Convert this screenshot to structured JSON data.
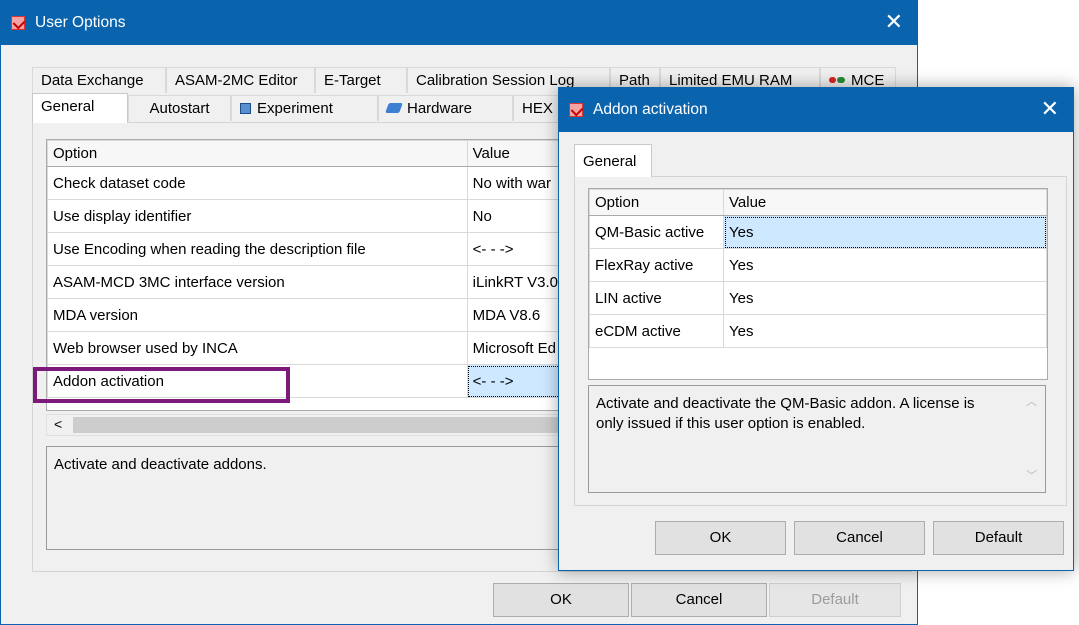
{
  "main_window": {
    "title": "User Options",
    "tabs_row1": [
      "Data Exchange",
      "ASAM-2MC Editor",
      "E-Target",
      "Calibration Session Log",
      "Path",
      "Limited EMU RAM",
      "MCE"
    ],
    "tabs_row2": [
      "General",
      "Autostart",
      "Experiment",
      "Hardware",
      "HEX"
    ],
    "active_tab": "General",
    "grid": {
      "columns": [
        "Option",
        "Value"
      ],
      "rows": [
        {
          "option": "Check dataset code",
          "value": "No with war"
        },
        {
          "option": "Use display identifier",
          "value": "No"
        },
        {
          "option": "Use Encoding when reading the description file",
          "value": "<- - ->"
        },
        {
          "option": "ASAM-MCD 3MC interface version",
          "value": "iLinkRT V3.0"
        },
        {
          "option": "MDA version",
          "value": "MDA V8.6"
        },
        {
          "option": "Web browser used by INCA",
          "value": "Microsoft Ed"
        },
        {
          "option": "Addon activation",
          "value": "<- - ->"
        }
      ],
      "selected_row": "Addon activation"
    },
    "scroll_left": "<",
    "description": "Activate and deactivate addons.",
    "buttons": {
      "ok": "OK",
      "cancel": "Cancel",
      "default": "Default"
    }
  },
  "addon_dialog": {
    "title": "Addon activation",
    "tab": "General",
    "grid": {
      "columns": [
        "Option",
        "Value"
      ],
      "rows": [
        {
          "option": "QM-Basic active",
          "value": "Yes"
        },
        {
          "option": "FlexRay active",
          "value": "Yes"
        },
        {
          "option": "LIN active",
          "value": "Yes"
        },
        {
          "option": "eCDM active",
          "value": "Yes"
        }
      ],
      "selected_row": "QM-Basic active"
    },
    "description": "Activate and deactivate the QM-Basic addon. A license is only issued if this user option is enabled.",
    "buttons": {
      "ok": "OK",
      "cancel": "Cancel",
      "default": "Default"
    }
  },
  "colors": {
    "titlebar": "#0a64ad",
    "highlight_box": "#7b1a7b",
    "selection": "#cde8ff"
  }
}
